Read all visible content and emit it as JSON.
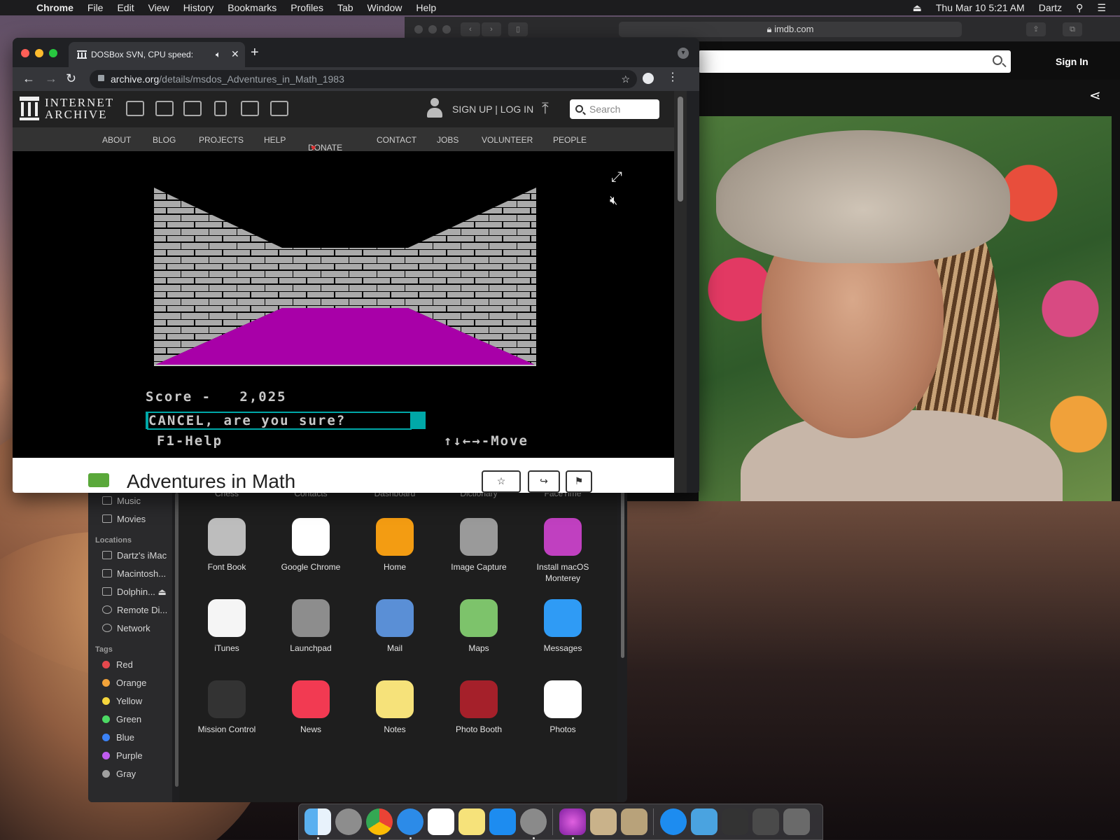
{
  "menubar": {
    "app": "Chrome",
    "items": [
      "File",
      "Edit",
      "View",
      "History",
      "Bookmarks",
      "Profiles",
      "Tab",
      "Window",
      "Help"
    ],
    "datetime": "Thu Mar 10  5:21 AM",
    "user": "Dartz"
  },
  "safari": {
    "address": "imdb.com",
    "sign_in": "Sign In"
  },
  "chrome": {
    "tab_title": "DOSBox SVN, CPU speed:",
    "url_host": "archive.org",
    "url_path": "/details/msdos_Adventures_in_Math_1983"
  },
  "ia": {
    "logo_line1": "INTERNET",
    "logo_line2": "ARCHIVE",
    "signup": "SIGN UP | LOG IN",
    "search_placeholder": "Search",
    "nav": [
      "ABOUT",
      "BLOG",
      "PROJECTS",
      "HELP",
      "DONATE",
      "CONTACT",
      "JOBS",
      "VOLUNTEER",
      "PEOPLE"
    ],
    "item_title": "Adventures in Math"
  },
  "game": {
    "score_line": "Score -   2,025",
    "prompt": "CANCEL, are you sure?",
    "help": "F1-Help",
    "move": "↑↓←→-Move",
    "floor_color": "#a800a8",
    "wall_color": "#aaaaaa"
  },
  "finder": {
    "sidebar": {
      "media": [
        "Music",
        "Movies"
      ],
      "locations_header": "Locations",
      "locations": [
        "Dartz's iMac",
        "Macintosh...",
        "Dolphin...",
        "Remote Di...",
        "Network"
      ],
      "tags_header": "Tags",
      "tags": [
        {
          "name": "Red",
          "color": "#e5484d"
        },
        {
          "name": "Orange",
          "color": "#f2a33a"
        },
        {
          "name": "Yellow",
          "color": "#f5d63d"
        },
        {
          "name": "Green",
          "color": "#4cd964"
        },
        {
          "name": "Blue",
          "color": "#3b82f6"
        },
        {
          "name": "Purple",
          "color": "#c05cf0"
        },
        {
          "name": "Gray",
          "color": "#a0a0a0"
        }
      ]
    },
    "top_row": [
      "Chess",
      "Contacts",
      "Dashboard",
      "Dictionary",
      "FaceTime"
    ],
    "apps": [
      {
        "name": "Font Book",
        "icon": "font-book-icon",
        "color": "#bdbdbd"
      },
      {
        "name": "Google Chrome",
        "icon": "chrome-icon",
        "color": "#ffffff"
      },
      {
        "name": "Home",
        "icon": "home-icon",
        "color": "#f39c12"
      },
      {
        "name": "Image Capture",
        "icon": "image-capture-icon",
        "color": "#9a9a9a"
      },
      {
        "name": "Install macOS Monterey",
        "icon": "installer-icon",
        "color": "#c040c0"
      },
      {
        "name": "iTunes",
        "icon": "itunes-icon",
        "color": "#f5f5f5"
      },
      {
        "name": "Launchpad",
        "icon": "launchpad-icon",
        "color": "#8d8d8d"
      },
      {
        "name": "Mail",
        "icon": "mail-icon",
        "color": "#5a8fd6"
      },
      {
        "name": "Maps",
        "icon": "maps-icon",
        "color": "#7dc36b"
      },
      {
        "name": "Messages",
        "icon": "messages-icon",
        "color": "#2f9bf5"
      },
      {
        "name": "Mission Control",
        "icon": "mission-control-icon",
        "color": "#333333"
      },
      {
        "name": "News",
        "icon": "news-icon",
        "color": "#f23a52"
      },
      {
        "name": "Notes",
        "icon": "notes-icon",
        "color": "#f6e27a"
      },
      {
        "name": "Photo Booth",
        "icon": "photo-booth-icon",
        "color": "#a5202a"
      },
      {
        "name": "Photos",
        "icon": "photos-icon",
        "color": "#ffffff"
      }
    ]
  }
}
